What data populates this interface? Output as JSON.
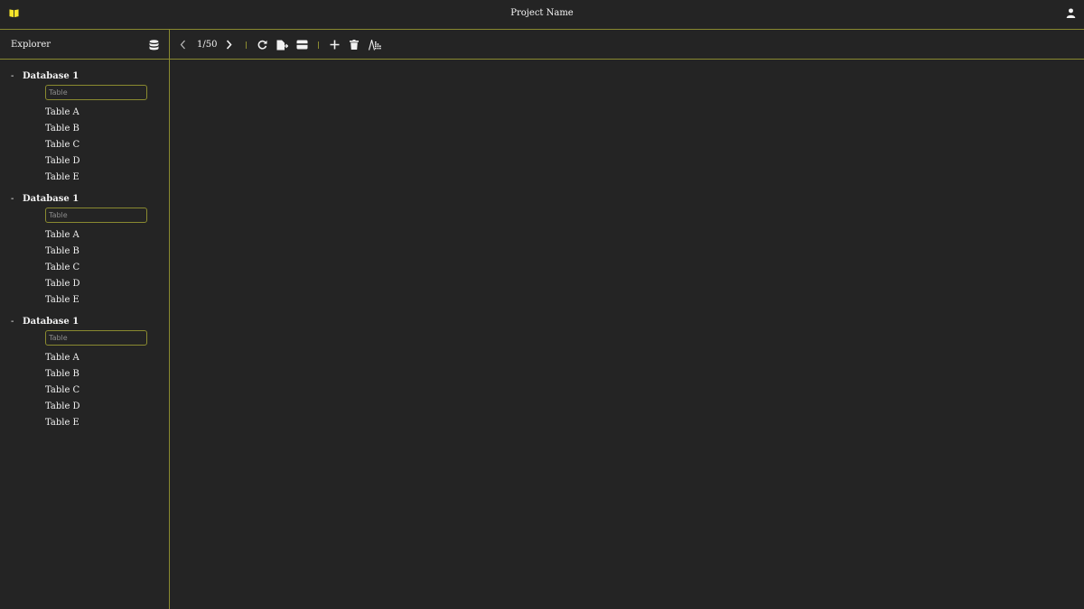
{
  "header": {
    "logo_icon": "book-icon",
    "project_name": "Project Name",
    "user_icon": "user-icon"
  },
  "sidebar": {
    "title": "Explorer",
    "header_icon": "database-icon",
    "databases": [
      {
        "toggle": "-",
        "name": "Database 1",
        "filter_placeholder": "Table",
        "tables": [
          "Table A",
          "Table B",
          "Table C",
          "Table D",
          "Table E"
        ]
      },
      {
        "toggle": "-",
        "name": "Database 1",
        "filter_placeholder": "Table",
        "tables": [
          "Table A",
          "Table B",
          "Table C",
          "Table D",
          "Table E"
        ]
      },
      {
        "toggle": "-",
        "name": "Database 1",
        "filter_placeholder": "Table",
        "tables": [
          "Table A",
          "Table B",
          "Table C",
          "Table D",
          "Table E"
        ]
      }
    ]
  },
  "toolbar": {
    "pagination": "1/50",
    "tools": [
      "chevron-left-icon",
      "chevron-right-icon",
      "refresh-icon",
      "export-file-icon",
      "card-icon",
      "plus-icon",
      "trash-icon",
      "sort-data-icon"
    ]
  },
  "colors": {
    "background": "#242424",
    "border_accent": "#8a8a30",
    "logo_yellow": "#f5e52a",
    "text": "#f2f2f2"
  }
}
